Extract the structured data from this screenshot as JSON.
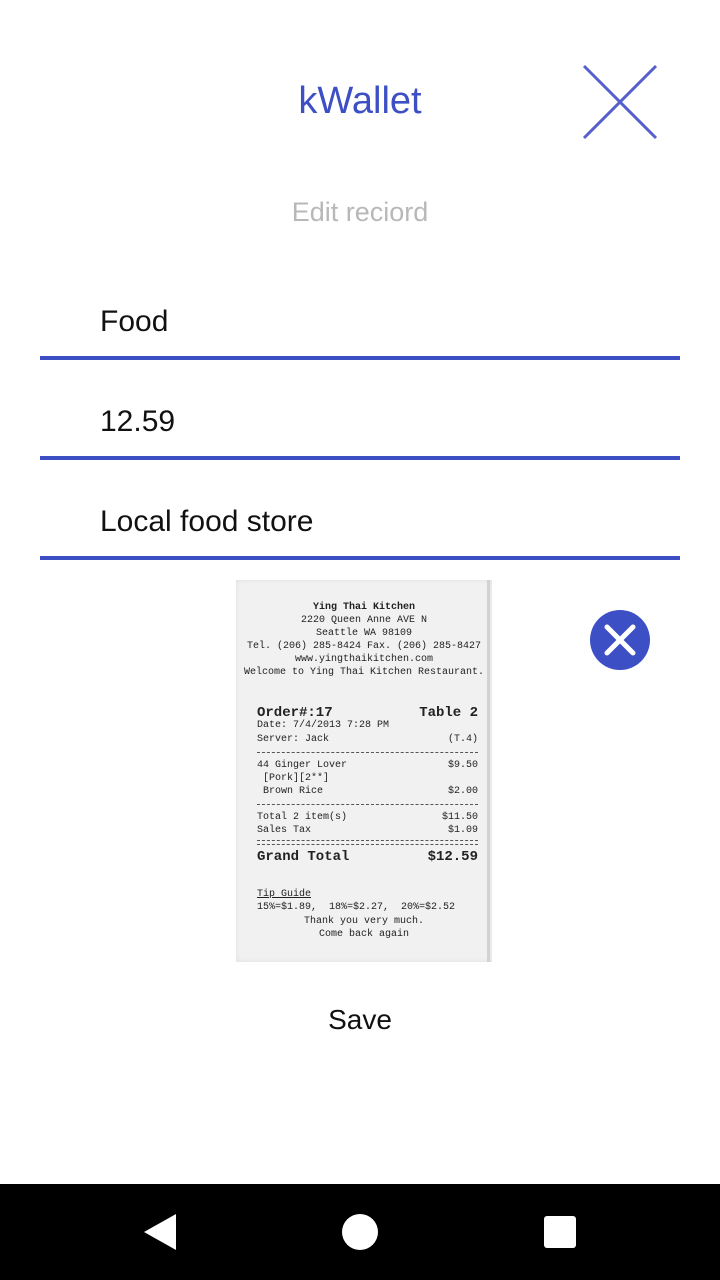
{
  "app": {
    "title": "kWallet",
    "subtitle": "Edit reciord"
  },
  "colors": {
    "accent": "#3d4fc4",
    "subtitle": "#b8b8b8",
    "nav_bar": "#000000"
  },
  "icons": {
    "close": "close-icon",
    "remove_image": "remove-image-icon",
    "back": "back-icon",
    "home": "home-icon",
    "recents": "recents-icon"
  },
  "form": {
    "category": "Food",
    "amount": "12.59",
    "description": "Local food store"
  },
  "receipt": {
    "name": "Ying Thai Kitchen",
    "address": "2220 Queen Anne AVE N",
    "city": "Seattle WA 98109",
    "phone": "Tel. (206) 285-8424 Fax. (206) 285-8427",
    "website": "www.yingthaikitchen.com",
    "welcome": "Welcome to Ying Thai Kitchen Restaurant.",
    "order": "Order#:17",
    "table": "Table 2",
    "date": "Date: 7/4/2013 7:28 PM",
    "server": "Server: Jack",
    "table_code": "(T.4)",
    "items": [
      {
        "name": "44 Ginger Lover",
        "price": "$9.50"
      },
      {
        "name": " [Pork][2**]",
        "price": ""
      },
      {
        "name": " Brown Rice",
        "price": "$2.00"
      }
    ],
    "total_label": "Total 2 item(s)",
    "total_value": "$11.50",
    "tax_label": "Sales Tax",
    "tax_value": "$1.09",
    "grand_label": "Grand Total",
    "grand_value": "$12.59",
    "tip_title": "Tip Guide",
    "tip_line": "15%=$1.89,  18%=$2.27,  20%=$2.52",
    "thanks": "Thank you very much.",
    "come_back": "Come back again"
  },
  "actions": {
    "save_label": "Save"
  }
}
